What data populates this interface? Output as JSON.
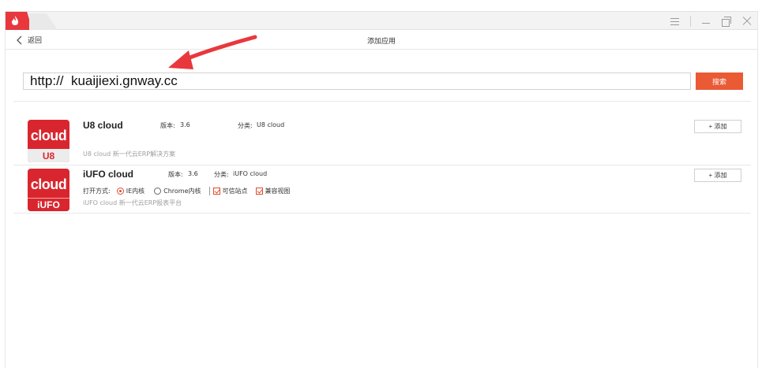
{
  "window": {
    "accent": "#e8383d"
  },
  "header": {
    "back_label": "返回",
    "title": "添加应用"
  },
  "search": {
    "value": "http://  kuaijiexi.gnway.cc",
    "button_label": "搜索",
    "button_color": "#ea5a35"
  },
  "apps": [
    {
      "name": "U8 cloud",
      "logo_word": "cloud",
      "logo_sub": "U8",
      "version_label": "版本:",
      "version": "3.6",
      "category_label": "分类:",
      "category": "U8 cloud",
      "description": "U8  cloud  新一代云ERP解决方案",
      "add_label": "+ 添加"
    },
    {
      "name": "iUFO cloud",
      "logo_word": "cloud",
      "logo_sub": "iUFO",
      "version_label": "版本:",
      "version": "3.6",
      "category_label": "分类:",
      "category": "iUFO cloud",
      "open_mode_label": "打开方式:",
      "options": {
        "ie": "IE内核",
        "chrome": "Chrome内核",
        "trusted": "可信站点",
        "compat": "兼容视图"
      },
      "description": "iUFO  cloud 新一代云ERP报表平台",
      "add_label": "+ 添加"
    }
  ]
}
